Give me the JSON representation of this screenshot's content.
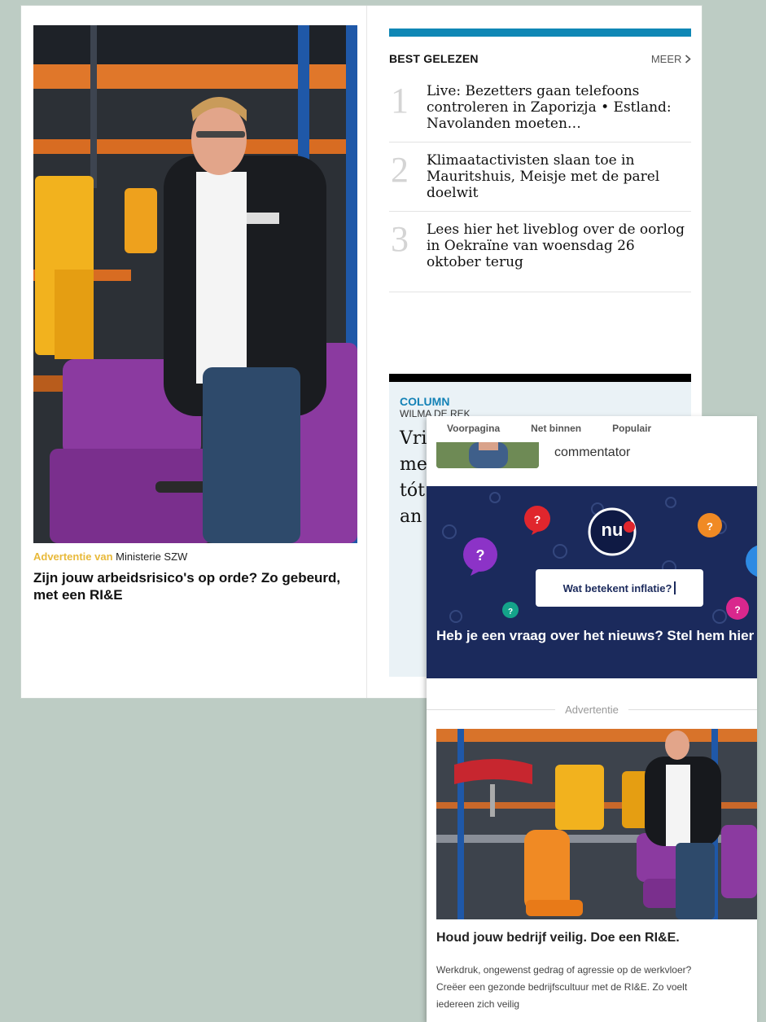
{
  "colors": {
    "background": "#bdccc4",
    "best_accent": "#0f87b5",
    "column_accent": "#1482b6",
    "ad_prefix": "#e8b93a",
    "quiz_banner": "#1b2a5c"
  },
  "left_ad": {
    "prefix": "Advertentie van",
    "sponsor": "Ministerie SZW",
    "headline": "Zijn jouw arbeidsrisico's op orde? Zo gebeurd, met een RI&E"
  },
  "best_read": {
    "title": "BEST GELEZEN",
    "more_label": "MEER",
    "more_icon": "chevron-right-icon",
    "items": [
      {
        "rank": "1",
        "text": "Live: Bezetters gaan telefoons controleren in Zaporizja • Estland: Navolanden moeten…"
      },
      {
        "rank": "2",
        "text": "Klimaatactivisten slaan toe in Mauritshuis, Meisje met de parel doelwit"
      },
      {
        "rank": "3",
        "text": "Lees hier het liveblog over de oorlog in Oekraïne van woensdag 26 oktober terug"
      }
    ]
  },
  "column": {
    "kicker": "COLUMN",
    "author": "WILMA DE REK",
    "title_fragment": "Vri me tót an"
  },
  "phone": {
    "nav": [
      "Voorpagina",
      "Net binnen",
      "Populair"
    ],
    "author_role": "commentator",
    "quiz": {
      "logo": "nu",
      "input_text": "Wat betekent inflatie?",
      "title": "Heb je een vraag over het nieuws? Stel hem hier"
    },
    "ad_label": "Advertentie",
    "ad_headline": "Houd jouw bedrijf veilig. Doe een RI&E.",
    "ad_body": [
      "Werkdruk, ongewenst gedrag of agressie op de werkvloer?",
      "Creëer een gezonde bedrijfscultuur met de RI&E. Zo voelt",
      "iedereen zich veilig"
    ]
  }
}
